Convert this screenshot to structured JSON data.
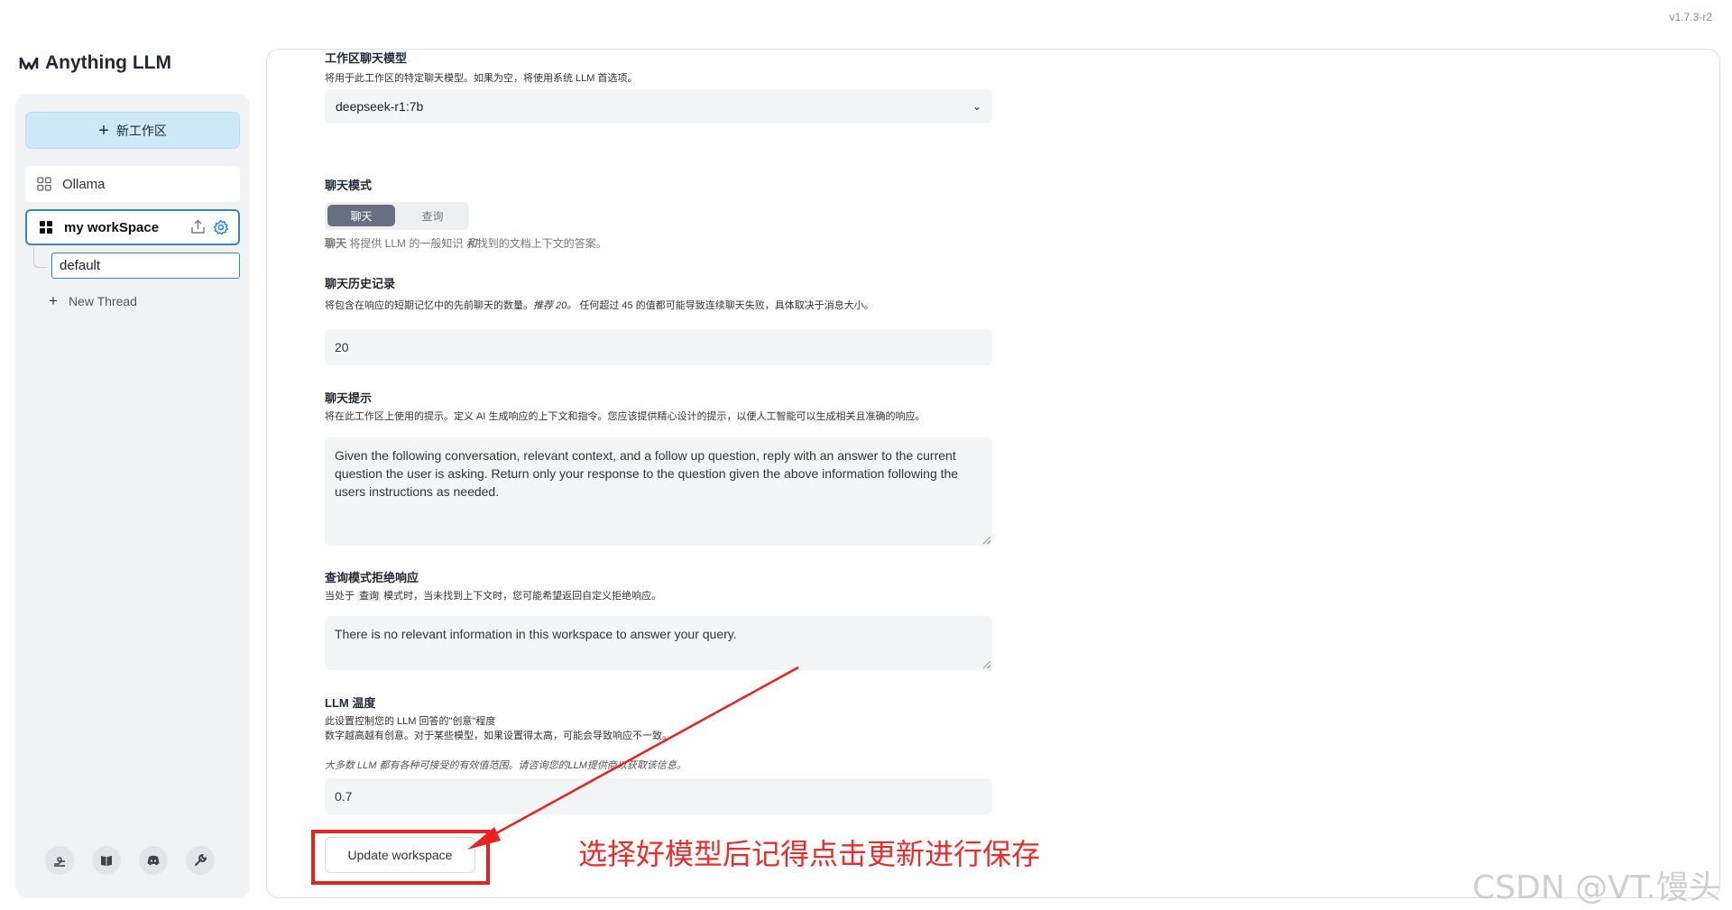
{
  "app": {
    "version": "v1.7.3-r2",
    "logo_text": "Anything LLM"
  },
  "sidebar": {
    "new_workspace_label": "新工作区",
    "workspaces": [
      {
        "name": "Ollama"
      },
      {
        "name": "my workSpace"
      }
    ],
    "threads": [
      {
        "name": "default"
      }
    ],
    "new_thread_label": "New Thread",
    "footer_icons": [
      "community-hub-icon",
      "docs-book-icon",
      "discord-icon",
      "settings-wrench-icon"
    ]
  },
  "settings": {
    "chat_model": {
      "title": "工作区聊天模型",
      "description": "将用于此工作区的特定聊天模型。如果为空，将使用系统 LLM 首选项。",
      "value": "deepseek-r1:7b"
    },
    "chat_mode": {
      "title": "聊天模式",
      "options": [
        "聊天",
        "查询"
      ],
      "selected": "聊天",
      "hint_prefix": "聊天",
      "hint_middle": " 将提供 LLM 的一般知识 ",
      "hint_em": "和",
      "hint_suffix": "找到的文档上下文的答案。"
    },
    "chat_history": {
      "title": "聊天历史记录",
      "description_prefix": "将包含在响应的短期记忆中的先前聊天的数量。",
      "description_em": "推荐 20。",
      "description_suffix": " 任何超过 45 的值都可能导致连续聊天失败，具体取决于消息大小。",
      "value": "20"
    },
    "chat_prompt": {
      "title": "聊天提示",
      "description": "将在此工作区上使用的提示。定义 AI 生成响应的上下文和指令。您应该提供精心设计的提示，以便人工智能可以生成相关且准确的响应。",
      "value": "Given the following conversation, relevant context, and a follow up question, reply with an answer to the current question the user is asking. Return only your response to the question given the above information following the users instructions as needed."
    },
    "query_refusal": {
      "title": "查询模式拒绝响应",
      "description_prefix": "当处于 ",
      "description_code": "查询",
      "description_suffix": " 模式时，当未找到上下文时，您可能希望返回自定义拒绝响应。",
      "value": "There is no relevant information in this workspace to answer your query."
    },
    "llm_temperature": {
      "title": "LLM 温度",
      "description_line1": "此设置控制您的 LLM 回答的\"创意\"程度",
      "description_line2": "数字越高越有创意。对于某些模型，如果设置得太高，可能会导致响应不一致。",
      "note": "大多数 LLM 都有各种可接受的有效值范围。请咨询您的LLM提供商以获取该信息。",
      "value": "0.7"
    },
    "update_button": "Update workspace"
  },
  "annotation": {
    "text": "选择好模型后记得点击更新进行保存",
    "color": "#e8221e"
  },
  "watermark": "CSDN @VT.馒头"
}
